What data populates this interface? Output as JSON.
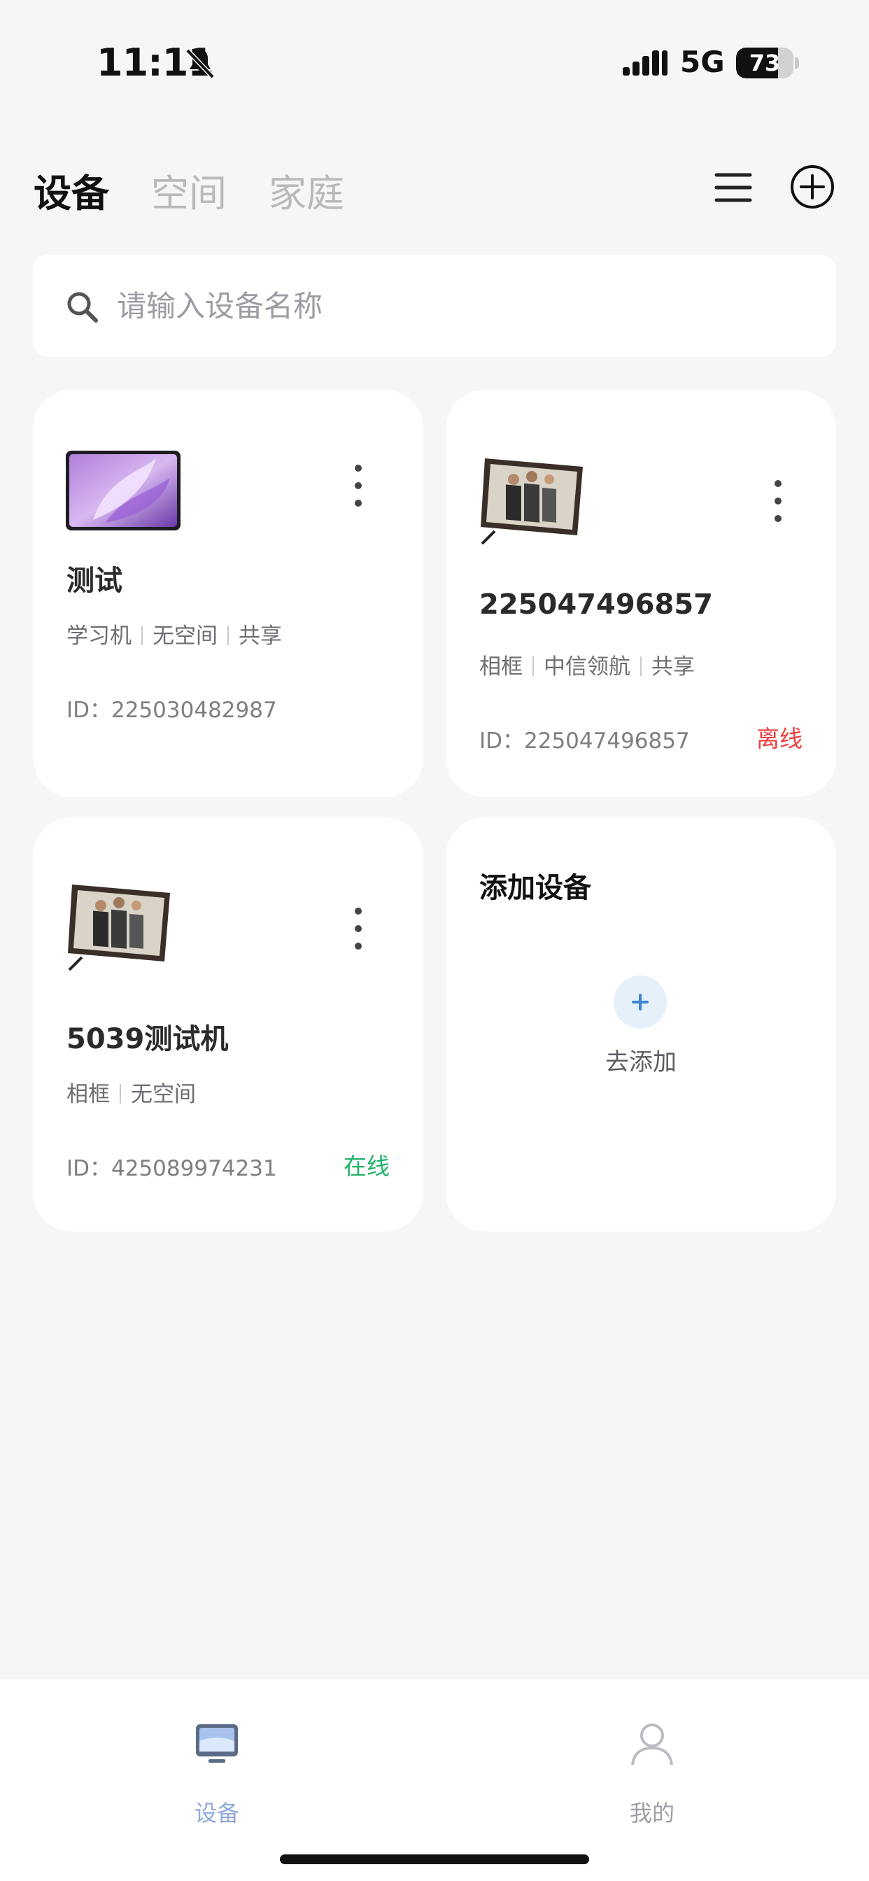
{
  "status_bar": {
    "time": "11:11",
    "network": "5G",
    "battery_percent": 73,
    "battery_label": "73"
  },
  "header": {
    "tabs": [
      {
        "label": "设备",
        "active": true
      },
      {
        "label": "空间",
        "active": false
      },
      {
        "label": "家庭",
        "active": false
      }
    ],
    "icons": [
      "menu-icon",
      "add-circle-icon"
    ]
  },
  "search": {
    "placeholder": "请输入设备名称",
    "value": ""
  },
  "devices": [
    {
      "name": "测试",
      "tags": [
        "学习机",
        "无空间",
        "共享"
      ],
      "id_label": "ID：225030482987",
      "status": "",
      "thumbnail": "tablet-image"
    },
    {
      "name": "225047496857",
      "tags": [
        "相框",
        "中信领航",
        "共享"
      ],
      "id_label": "ID：225047496857",
      "status": "离线",
      "thumbnail": "photo-frame-image"
    },
    {
      "name": "5039测试机",
      "tags": [
        "相框",
        "无空间"
      ],
      "id_label": "ID：425089974231",
      "status": "在线",
      "thumbnail": "photo-frame-image"
    }
  ],
  "add_card": {
    "title": "添加设备",
    "button_label": "去添加"
  },
  "bottom_nav": [
    {
      "label": "设备",
      "active": true,
      "icon": "monitor-icon"
    },
    {
      "label": "我的",
      "active": false,
      "icon": "user-icon"
    }
  ],
  "colors": {
    "background": "#f5f6f8",
    "offline": "#ef3e3e",
    "online": "#1fb36a",
    "nav_active": "#8fa9de",
    "add_accent": "#3a87d6"
  }
}
